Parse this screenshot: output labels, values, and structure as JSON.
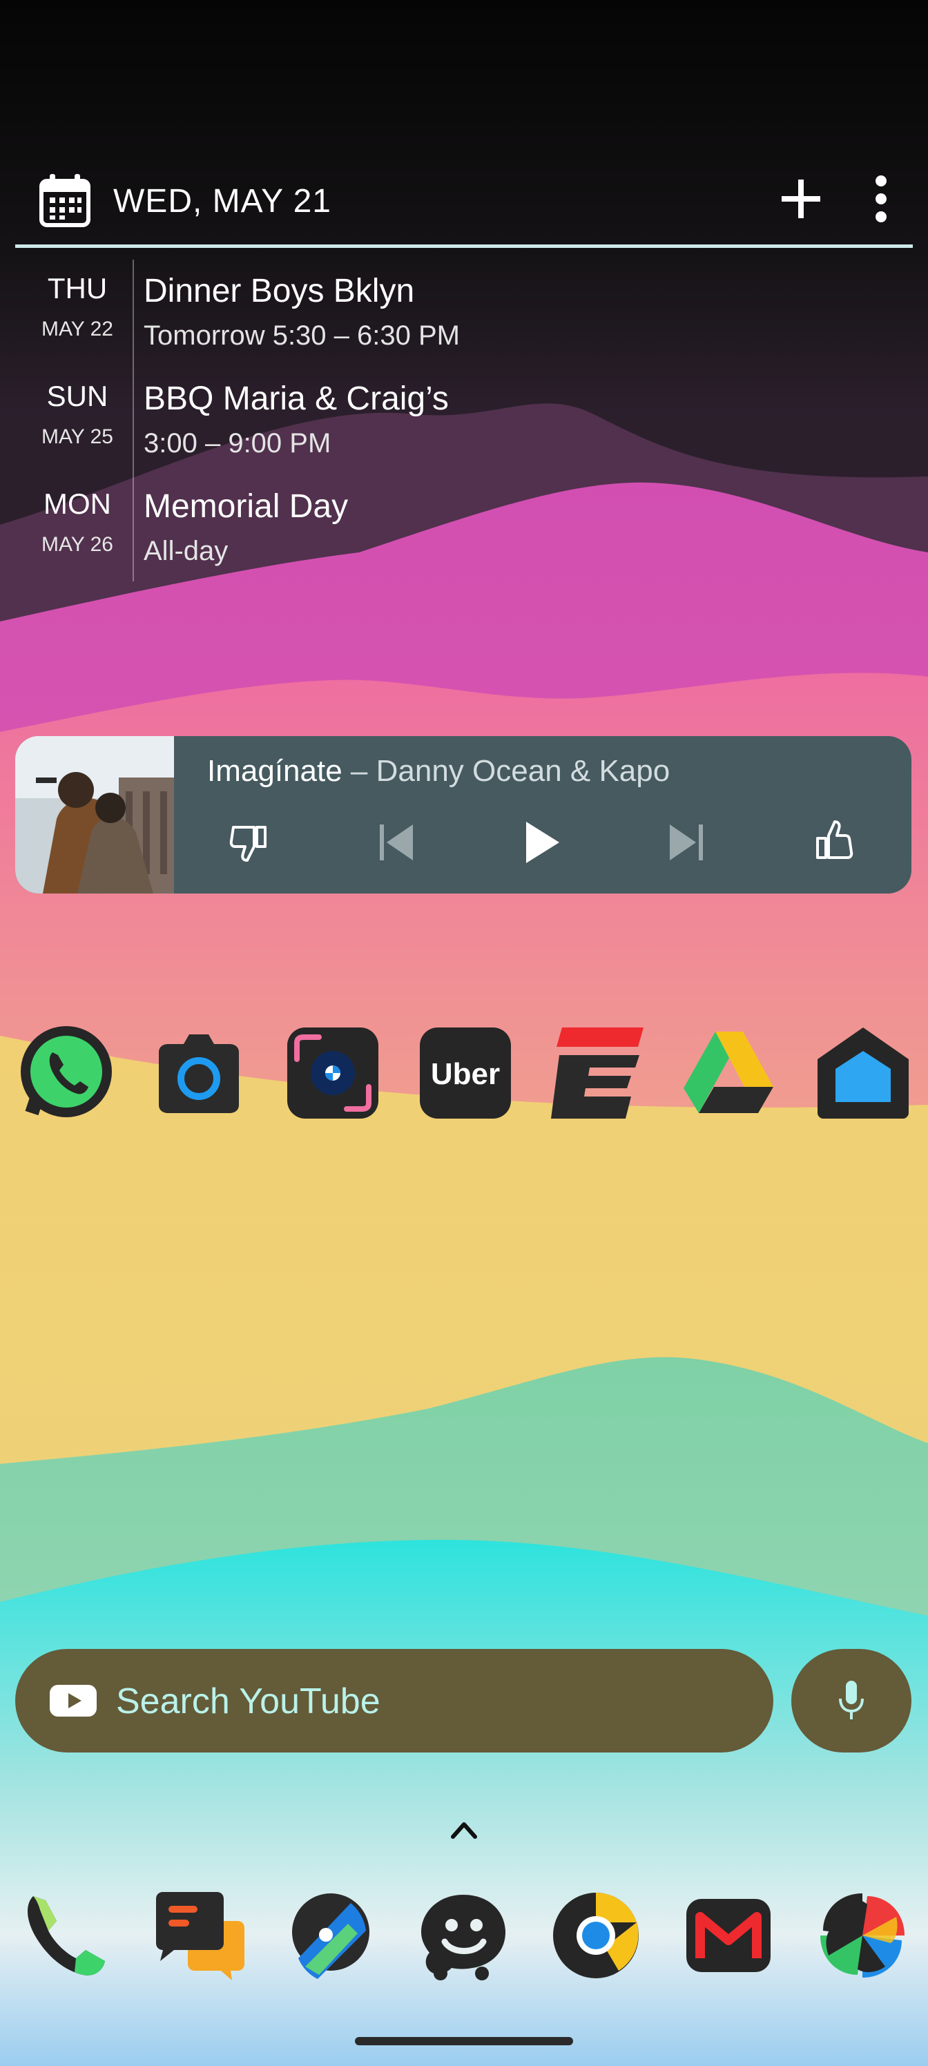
{
  "calendar": {
    "date_label": "WED, MAY 21",
    "events": [
      {
        "dow": "THU",
        "month_day": "MAY 22",
        "title": "Dinner Boys Bklyn",
        "time": "Tomorrow 5:30 – 6:30 PM"
      },
      {
        "dow": "SUN",
        "month_day": "MAY 25",
        "title": "BBQ Maria & Craig’s",
        "time": "3:00 – 9:00 PM"
      },
      {
        "dow": "MON",
        "month_day": "MAY 26",
        "title": "Memorial Day",
        "time": "All-day"
      }
    ]
  },
  "music": {
    "title": "Imagínate",
    "separator": " – ",
    "artist": "Danny Ocean & Kapo",
    "controls": [
      "thumbs-down-icon",
      "skip-previous-icon",
      "play-icon",
      "skip-next-icon",
      "thumbs-up-icon"
    ]
  },
  "apps": [
    {
      "name": "whatsapp-icon"
    },
    {
      "name": "camera-icon"
    },
    {
      "name": "my-bmw-icon"
    },
    {
      "name": "uber-icon",
      "label": "Uber"
    },
    {
      "name": "espn-icon"
    },
    {
      "name": "google-drive-icon"
    },
    {
      "name": "google-home-icon"
    }
  ],
  "youtube_search": {
    "placeholder": "Search YouTube"
  },
  "dock": [
    {
      "name": "phone-icon"
    },
    {
      "name": "messages-icon"
    },
    {
      "name": "maps-icon"
    },
    {
      "name": "waze-icon"
    },
    {
      "name": "chrome-icon"
    },
    {
      "name": "gmail-icon"
    },
    {
      "name": "photos-icon"
    }
  ],
  "colors": {
    "music_widget": "#465a60",
    "search_bar": "#645b39",
    "search_text": "#b9f2ea",
    "calendar_rule": "#cfe8ea"
  }
}
